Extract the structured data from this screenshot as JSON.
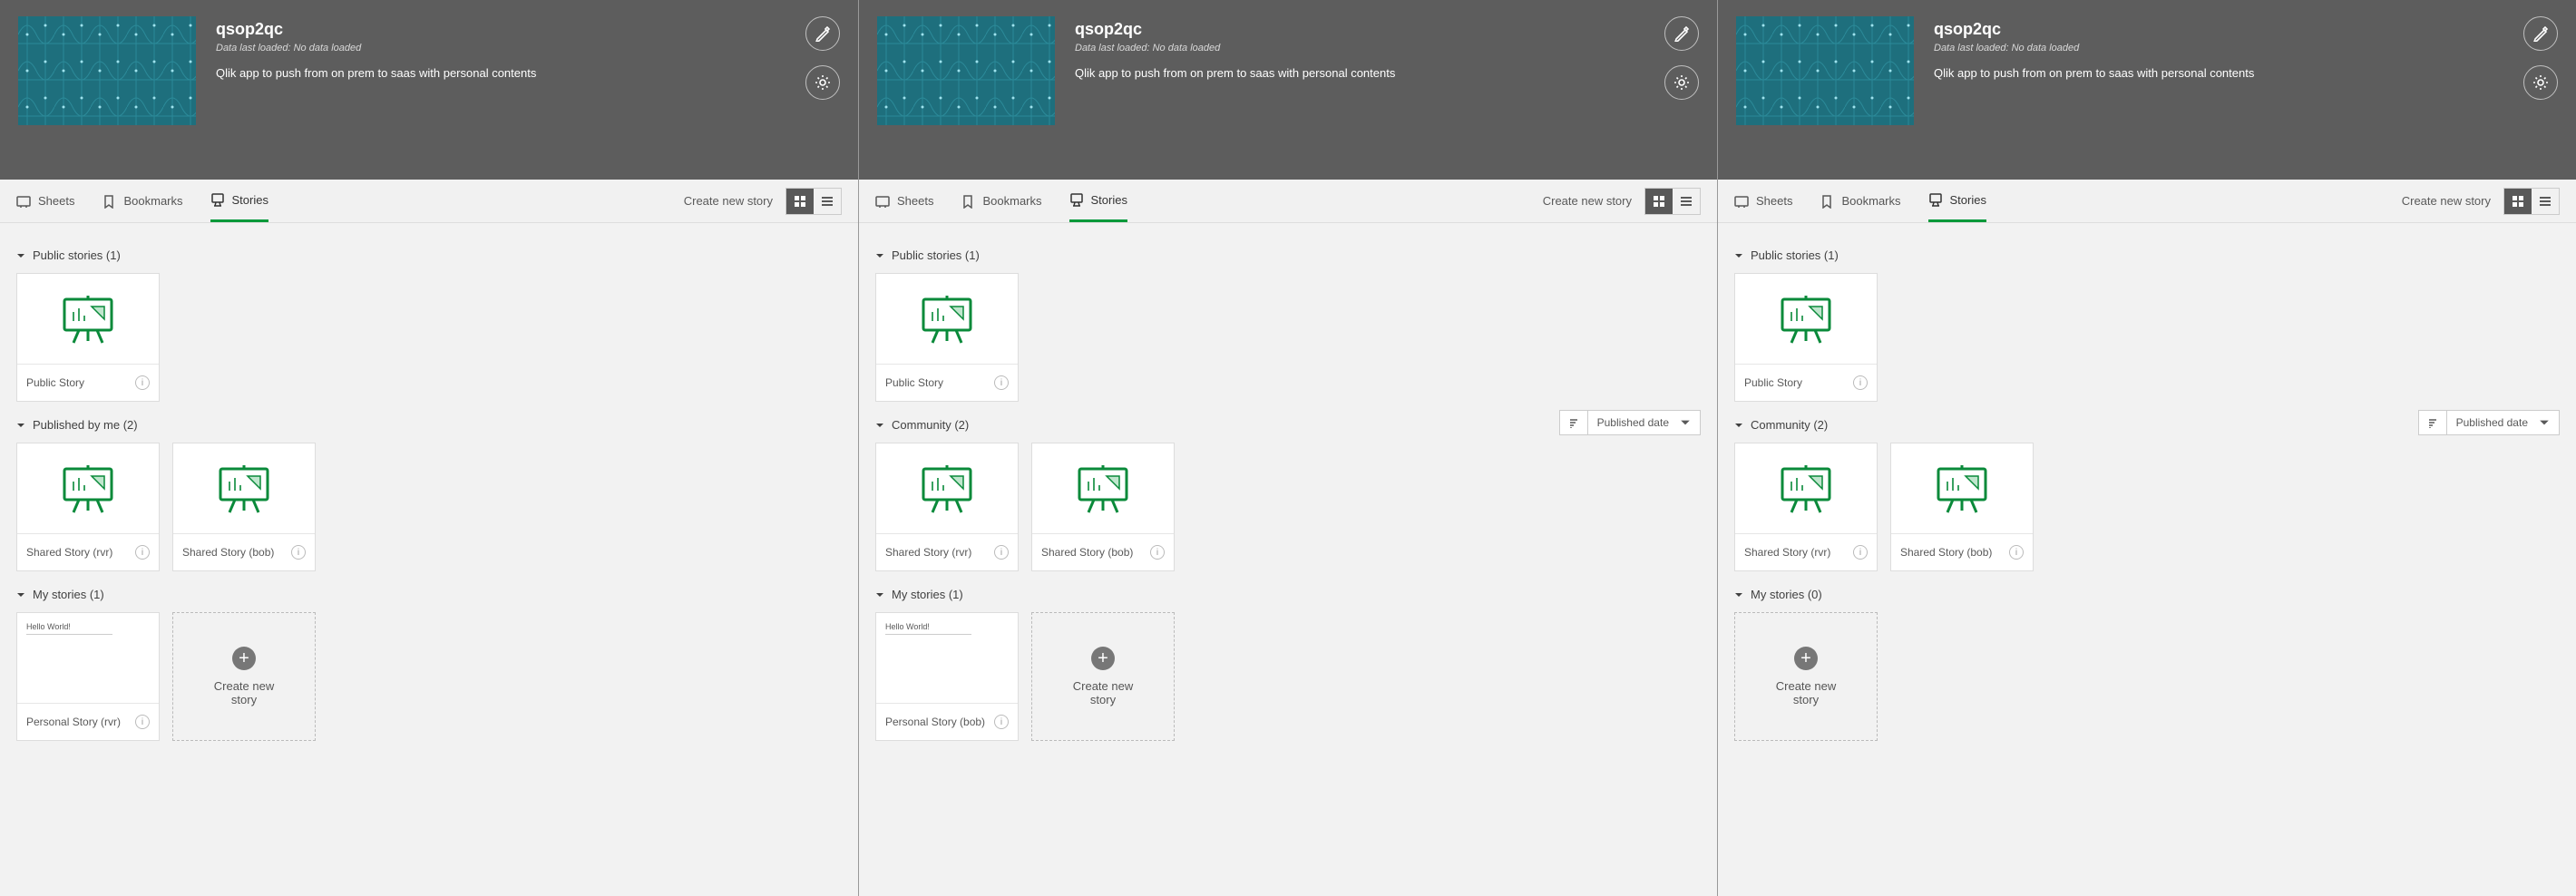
{
  "app": {
    "title": "qsop2qc",
    "subtitle": "Data last loaded: No data loaded",
    "description": "Qlik app to push from on prem to saas with personal contents"
  },
  "tabs": {
    "sheets": "Sheets",
    "bookmarks": "Bookmarks",
    "stories": "Stories"
  },
  "actions": {
    "create_story": "Create new story",
    "create_new_story_card": "Create new story"
  },
  "sort": {
    "label": "Published date"
  },
  "panels": [
    {
      "sections": [
        {
          "key": "public",
          "title": "Public stories (1)",
          "sort": false,
          "cards": [
            {
              "name": "Public Story",
              "kind": "easel"
            }
          ]
        },
        {
          "key": "pubme",
          "title": "Published by me (2)",
          "sort": false,
          "cards": [
            {
              "name": "Shared Story (rvr)",
              "kind": "easel"
            },
            {
              "name": "Shared Story (bob)",
              "kind": "easel"
            }
          ]
        },
        {
          "key": "my",
          "title": "My stories (1)",
          "sort": false,
          "cards": [
            {
              "name": "Personal Story (rvr)",
              "kind": "text",
              "text": "Hello World!"
            }
          ],
          "create": true
        }
      ]
    },
    {
      "sections": [
        {
          "key": "public",
          "title": "Public stories (1)",
          "sort": false,
          "cards": [
            {
              "name": "Public Story",
              "kind": "easel"
            }
          ]
        },
        {
          "key": "community",
          "title": "Community (2)",
          "sort": true,
          "cards": [
            {
              "name": "Shared Story (rvr)",
              "kind": "easel"
            },
            {
              "name": "Shared Story (bob)",
              "kind": "easel"
            }
          ]
        },
        {
          "key": "my",
          "title": "My stories (1)",
          "sort": false,
          "cards": [
            {
              "name": "Personal Story (bob)",
              "kind": "text",
              "text": "Hello World!"
            }
          ],
          "create": true
        }
      ]
    },
    {
      "sections": [
        {
          "key": "public",
          "title": "Public stories (1)",
          "sort": false,
          "cards": [
            {
              "name": "Public Story",
              "kind": "easel"
            }
          ]
        },
        {
          "key": "community",
          "title": "Community (2)",
          "sort": true,
          "cards": [
            {
              "name": "Shared Story (rvr)",
              "kind": "easel"
            },
            {
              "name": "Shared Story (bob)",
              "kind": "easel"
            }
          ]
        },
        {
          "key": "my",
          "title": "My stories (0)",
          "sort": false,
          "cards": [],
          "create": true
        }
      ]
    }
  ]
}
